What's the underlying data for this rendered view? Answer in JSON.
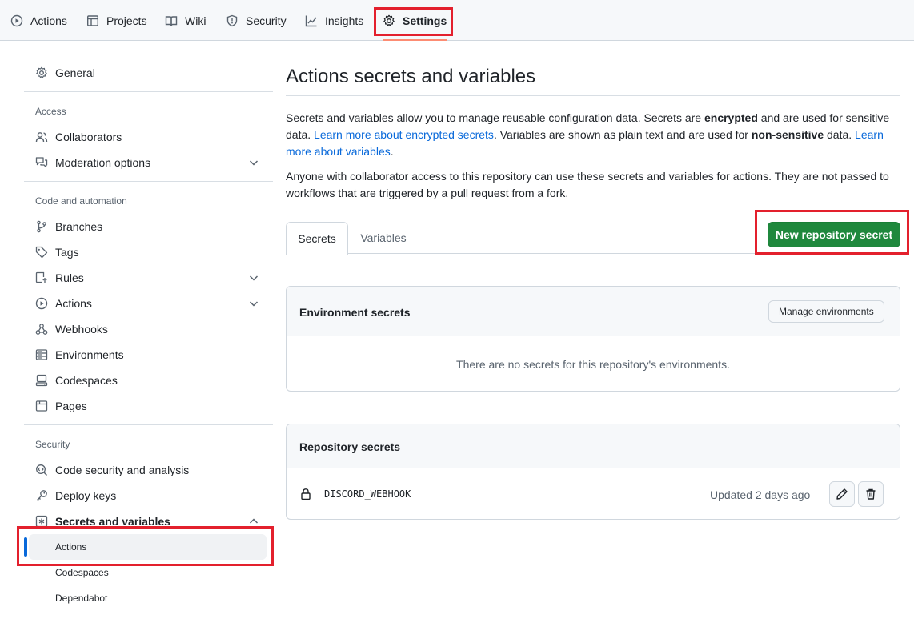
{
  "topnav": {
    "tabs": [
      {
        "label": "Actions",
        "icon": "play-icon"
      },
      {
        "label": "Projects",
        "icon": "table-icon"
      },
      {
        "label": "Wiki",
        "icon": "book-icon"
      },
      {
        "label": "Security",
        "icon": "shield-icon"
      },
      {
        "label": "Insights",
        "icon": "graph-icon"
      },
      {
        "label": "Settings",
        "icon": "gear-icon",
        "active": true
      }
    ]
  },
  "sidebar": {
    "general": "General",
    "sections": {
      "access": "Access",
      "code": "Code and automation",
      "security": "Security"
    },
    "items": {
      "collaborators": "Collaborators",
      "moderation": "Moderation options",
      "branches": "Branches",
      "tags": "Tags",
      "rules": "Rules",
      "actions": "Actions",
      "webhooks": "Webhooks",
      "environments": "Environments",
      "codespaces": "Codespaces",
      "pages": "Pages",
      "code_security": "Code security and analysis",
      "deploy_keys": "Deploy keys",
      "secrets": "Secrets and variables",
      "sub_actions": "Actions",
      "sub_codespaces": "Codespaces",
      "sub_dependabot": "Dependabot"
    }
  },
  "main": {
    "title": "Actions secrets and variables",
    "p1": {
      "a": "Secrets and variables allow you to manage reusable configuration data. Secrets are ",
      "b": "encrypted",
      "c": " and are used for sensitive data. ",
      "link1": "Learn more about encrypted secrets",
      "d": ". Variables are shown as plain text and are used for ",
      "e": "non-sensitive",
      "f": " data. ",
      "link2": "Learn more about variables",
      "g": "."
    },
    "p2": "Anyone with collaborator access to this repository can use these secrets and variables for actions. They are not passed to workflows that are triggered by a pull request from a fork.",
    "tabs": {
      "secrets": "Secrets",
      "variables": "Variables"
    },
    "new_secret_button": "New repository secret",
    "env_box": {
      "title": "Environment secrets",
      "manage_button": "Manage environments",
      "empty": "There are no secrets for this repository's environments."
    },
    "repo_box": {
      "title": "Repository secrets",
      "secret_name": "DISCORD_WEBHOOK",
      "updated": "Updated 2 days ago"
    }
  },
  "colors": {
    "accent": "#0969da",
    "primary_button": "#1f883d",
    "highlight": "#e3202d"
  }
}
